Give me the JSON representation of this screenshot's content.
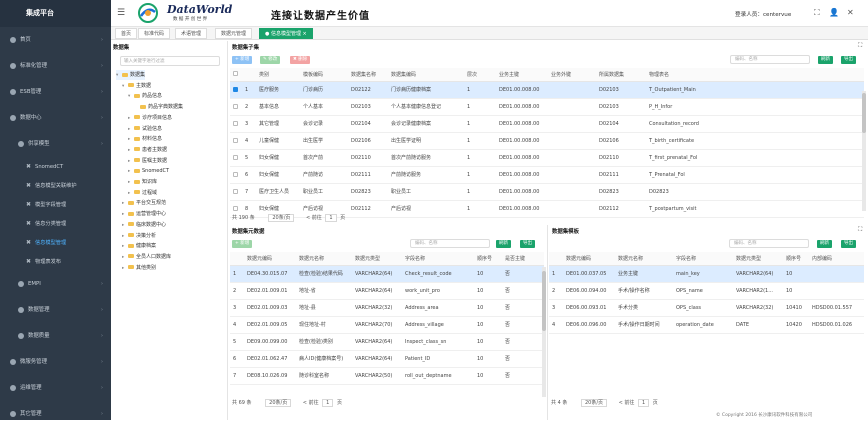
{
  "app": {
    "brand": "集成平台",
    "logo_title": "DataWorld",
    "logo_subtitle": "数 据 开 创 世 界",
    "slogan": "连接让数据产生价值",
    "user_label": "登录人员：centervue"
  },
  "sidebar": {
    "items": [
      {
        "label": "首页",
        "kind": "top"
      },
      {
        "label": "标准化管理",
        "kind": "top"
      },
      {
        "label": "ESB管理",
        "kind": "top"
      },
      {
        "label": "数据中心",
        "kind": "top"
      },
      {
        "label": "供享模型",
        "kind": "sub"
      },
      {
        "label": "SnomedCT",
        "kind": "sub2"
      },
      {
        "label": "信息模型关联维护",
        "kind": "sub2"
      },
      {
        "label": "模型字段管理",
        "kind": "sub2"
      },
      {
        "label": "信息分类管理",
        "kind": "sub2"
      },
      {
        "label": "信息模型管理",
        "kind": "sub2",
        "active": true
      },
      {
        "label": "物理表发布",
        "kind": "sub2"
      },
      {
        "label": "EMPI",
        "kind": "sub"
      },
      {
        "label": "数据管理",
        "kind": "sub"
      },
      {
        "label": "数据质量",
        "kind": "sub"
      },
      {
        "label": "微服务管理",
        "kind": "top"
      },
      {
        "label": "运维管理",
        "kind": "top"
      },
      {
        "label": "其它管理",
        "kind": "top"
      }
    ]
  },
  "tabs": [
    "首页",
    "标准代码",
    "术语管理",
    "数据元管理",
    "● 信息模型管理 ×"
  ],
  "tree": {
    "title": "数据集",
    "search_placeholder": "输入关键字进行过滤",
    "nodes": [
      {
        "label": "数据集",
        "level": 0,
        "caret": "▾"
      },
      {
        "label": "主数据",
        "level": 1,
        "caret": "▾"
      },
      {
        "label": "药品信息",
        "level": 2,
        "caret": "▾"
      },
      {
        "label": "药品字典数据集",
        "level": 3,
        "caret": ""
      },
      {
        "label": "诊疗项目信息",
        "level": 2,
        "caret": "▸"
      },
      {
        "label": "试验信息",
        "level": 2,
        "caret": "▸"
      },
      {
        "label": "材料信息",
        "level": 2,
        "caret": "▸"
      },
      {
        "label": "患者主数据",
        "level": 2,
        "caret": "▸"
      },
      {
        "label": "医嘱主数据",
        "level": 2,
        "caret": "▸"
      },
      {
        "label": "SnomedCT",
        "level": 2,
        "caret": "▸"
      },
      {
        "label": "知识库",
        "level": 2,
        "caret": "▸"
      },
      {
        "label": "过程域",
        "level": 2,
        "caret": "▸"
      },
      {
        "label": "平台交互规范",
        "level": 1,
        "caret": "▸"
      },
      {
        "label": "运营管理中心",
        "level": 1,
        "caret": "▸"
      },
      {
        "label": "临床数据中心",
        "level": 1,
        "caret": "▸"
      },
      {
        "label": "决策分析",
        "level": 1,
        "caret": "▸"
      },
      {
        "label": "健康档案",
        "level": 1,
        "caret": "▸"
      },
      {
        "label": "全员人口数据库",
        "level": 1,
        "caret": "▸"
      },
      {
        "label": "其他类别",
        "level": 1,
        "caret": "▸"
      }
    ]
  },
  "top_grid": {
    "title": "数据集子集",
    "buttons": {
      "add": "+ 新增",
      "edit": "✎ 修改",
      "delete": "✖ 删除",
      "refresh": "刷新",
      "export": "导出"
    },
    "search_placeholder": "编码、名称",
    "columns": [
      "",
      "类别",
      "模板编码",
      "数据集名称",
      "数据集编码",
      "层次",
      "业务主键",
      "业务外键",
      "所属数据集",
      "物理表名"
    ],
    "rows": [
      {
        "sel": true,
        "cells": [
          "1",
          "医疗服务",
          "门诊病历",
          "D02122",
          "门诊病历健康档案",
          "1",
          "DE01.00.008.00",
          "",
          "D02103",
          "T_Outpatient_Main"
        ]
      },
      {
        "sel": false,
        "cells": [
          "2",
          "基本信息",
          "个人基本",
          "D02103",
          "个人基本健康信息登记",
          "1",
          "DE01.00.008.00",
          "",
          "D02103",
          "P_H_Infor"
        ]
      },
      {
        "sel": false,
        "cells": [
          "3",
          "其它管理",
          "会诊记录",
          "D02104",
          "会诊记录健康档案",
          "1",
          "DE01.00.008.00",
          "",
          "D02104",
          "Consultation_record"
        ]
      },
      {
        "sel": false,
        "cells": [
          "4",
          "儿童保健",
          "出生医学",
          "D02106",
          "出生医学证明",
          "1",
          "DE01.00.008.00",
          "",
          "D02106",
          "T_birth_certificate"
        ]
      },
      {
        "sel": false,
        "cells": [
          "5",
          "妇女保健",
          "首次产前",
          "D02110",
          "首次产前随访服务",
          "1",
          "DE01.00.008.00",
          "",
          "D02110",
          "T_first_prenatal_Fol"
        ]
      },
      {
        "sel": false,
        "cells": [
          "6",
          "妇女保健",
          "产前随访",
          "D02111",
          "产前随访服务",
          "1",
          "DE01.00.008.00",
          "",
          "D02111",
          "T_Prenatal_Fol"
        ]
      },
      {
        "sel": false,
        "cells": [
          "7",
          "医疗卫生人员",
          "职业员工",
          "D02823",
          "职业员工",
          "1",
          "DE01.00.008.00",
          "",
          "D02823",
          "D02823"
        ]
      },
      {
        "sel": false,
        "cells": [
          "8",
          "妇女保健",
          "产后访视",
          "D02112",
          "产后访视",
          "1",
          "DE01.00.008.00",
          "",
          "D02112",
          "T_postpartum_visit"
        ]
      }
    ],
    "pager": {
      "total": "共 190 条",
      "size": "20条/页",
      "prev": "< 前往",
      "page": "1",
      "unit": "页"
    }
  },
  "bottom_left": {
    "title": "数据集元数据",
    "buttons": {
      "add": "+ 新增",
      "refresh": "刷新",
      "export": "导出"
    },
    "search_placeholder": "编码、名称",
    "columns": [
      "",
      "数据元编码",
      "数据元名称",
      "数据元类型",
      "字段名称",
      "顺序号",
      "是否主键"
    ],
    "rows": [
      {
        "sel": true,
        "cells": [
          "1",
          "DE04.30.015.07",
          "检查(检验)结果代码",
          "VARCHAR2(64)",
          "Check_result_code",
          "10",
          "否"
        ]
      },
      {
        "sel": false,
        "cells": [
          "2",
          "DE02.01.009.01",
          "地址-省",
          "VARCHAR2(64)",
          "work_unit_pro",
          "10",
          "否"
        ]
      },
      {
        "sel": false,
        "cells": [
          "3",
          "DE02.01.009.03",
          "地址-县",
          "VARCHAR2(32)",
          "Address_area",
          "10",
          "否"
        ]
      },
      {
        "sel": false,
        "cells": [
          "4",
          "DE02.01.009.05",
          "现住地址-村",
          "VARCHAR2(70)",
          "Address_village",
          "10",
          "否"
        ]
      },
      {
        "sel": false,
        "cells": [
          "5",
          "DE09.00.099.00",
          "检查(检验)类别",
          "VARCHAR2(64)",
          "Inspect_class_sn",
          "10",
          "否"
        ]
      },
      {
        "sel": false,
        "cells": [
          "6",
          "DE02.01.062.47",
          "病人ID(健康档案号)",
          "VARCHAR2(64)",
          "Patient_ID",
          "10",
          "否"
        ]
      },
      {
        "sel": false,
        "cells": [
          "7",
          "DE08.10.026.09",
          "随诊科室名称",
          "VARCHAR2(50)",
          "roll_out_deptname",
          "10",
          "否"
        ]
      }
    ],
    "pager": {
      "total": "共 69 条",
      "size": "20条/页",
      "prev": "< 前往",
      "page": "1",
      "unit": "页"
    }
  },
  "bottom_right": {
    "title": "数据集模板",
    "buttons": {
      "refresh": "刷新",
      "export": "导出"
    },
    "search_placeholder": "编码、名称",
    "columns": [
      "",
      "数据元编码",
      "数据元名称",
      "字段名称",
      "数据元类型",
      "顺序号",
      "内部编码"
    ],
    "rows": [
      {
        "sel": true,
        "cells": [
          "1",
          "DE01.00.037.05",
          "业务主键",
          "main_key",
          "VARCHAR2(64)",
          "10",
          ""
        ]
      },
      {
        "sel": false,
        "cells": [
          "2",
          "DE06.00.094.00",
          "手术/操作名称",
          "OPS_name",
          "VARCHAR2(1...",
          "10",
          ""
        ]
      },
      {
        "sel": false,
        "cells": [
          "3",
          "DE06.00.093.01",
          "手术分类",
          "OPS_class",
          "VARCHAR2(32)",
          "10410",
          "HDSD00.01.557"
        ]
      },
      {
        "sel": false,
        "cells": [
          "4",
          "DE06.00.096.00",
          "手术/操作日期时间",
          "operation_date",
          "DATE",
          "10420",
          "HDSD00.01.026"
        ]
      }
    ],
    "pager": {
      "total": "共 4 条",
      "size": "20条/页",
      "prev": "< 前往",
      "page": "1",
      "unit": "页"
    }
  },
  "footer": "© Copyright 2016 长沙康讯软件科技有限公司"
}
